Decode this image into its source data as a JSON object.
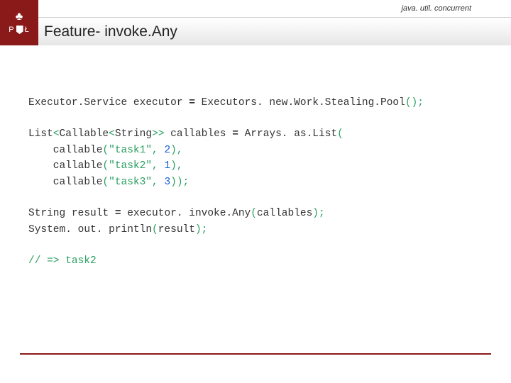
{
  "header": {
    "package": "java. util. concurrent",
    "title": "Feature- invoke.Any",
    "logo_top": "♣",
    "logo_p": "P",
    "logo_l": "Ł"
  },
  "code": {
    "line1": {
      "a": "Executor.Service executor ",
      "eq": "=",
      "b": " Executors. new.Work.Stealing.Pool",
      "paren": "();"
    },
    "line2": {
      "a": "List",
      "lt": "<",
      "b": "Callable",
      "lt2": "<",
      "c": "String",
      "gt2": ">>",
      "d": " callables ",
      "eq": "=",
      "e": " Arrays. as.List",
      "open": "("
    },
    "task1": {
      "indent": "    callable",
      "open": "(",
      "str": "\"task1\"",
      "comma": ", ",
      "num": "2",
      "close": "),"
    },
    "task2": {
      "indent": "    callable",
      "open": "(",
      "str": "\"task2\"",
      "comma": ", ",
      "num": "1",
      "close": "),"
    },
    "task3": {
      "indent": "    callable",
      "open": "(",
      "str": "\"task3\"",
      "comma": ", ",
      "num": "3",
      "close": "));"
    },
    "result": {
      "a": "String result ",
      "eq": "=",
      "b": " executor. invoke.Any",
      "open": "(",
      "arg": "callables",
      "close": ");"
    },
    "println": {
      "a": "System. out. println",
      "open": "(",
      "arg": "result",
      "close": ");"
    },
    "comment": "// => task2"
  }
}
